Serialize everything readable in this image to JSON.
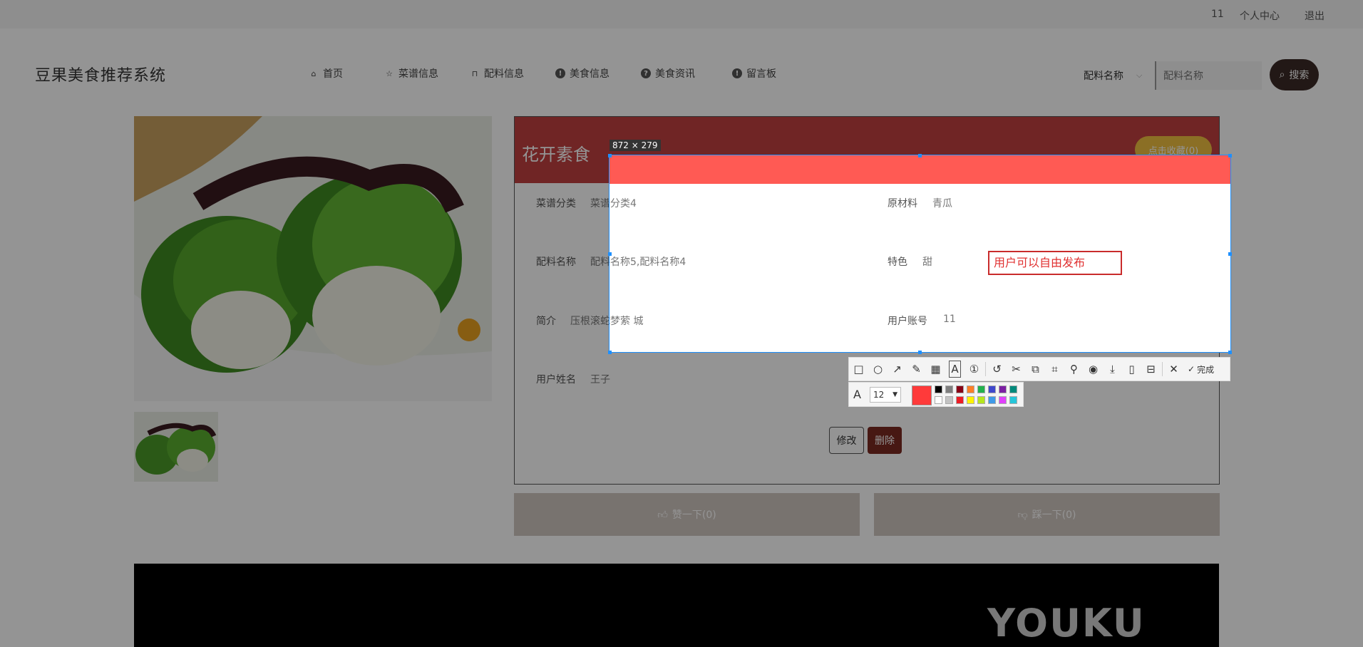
{
  "topbar": {
    "user_id": "11",
    "profile_link": "个人中心",
    "logout_link": "退出"
  },
  "site": {
    "title": "豆果美食推荐系统"
  },
  "nav": {
    "items": [
      {
        "label": "首页",
        "icon": "home-icon"
      },
      {
        "label": "菜谱信息",
        "icon": "star-icon"
      },
      {
        "label": "配料信息",
        "icon": "bag-icon"
      },
      {
        "label": "美食信息",
        "icon": "info-icon"
      },
      {
        "label": "美食资讯",
        "icon": "help-icon"
      },
      {
        "label": "留言板",
        "icon": "info-icon"
      }
    ]
  },
  "search": {
    "select_value": "配料名称",
    "placeholder": "配料名称",
    "button_label": "搜索"
  },
  "dish": {
    "title": "花开素食",
    "favorite_label": "点击收藏(0)",
    "fields": {
      "category_label": "菜谱分类",
      "category_value": "菜谱分类4",
      "material_label": "原材料",
      "material_value": "青瓜",
      "ingredient_label": "配料名称",
      "ingredient_value": "配料名称5,配料名称4",
      "feature_label": "特色",
      "feature_value": "甜",
      "intro_label": "简介",
      "intro_value": "压根滚蛇梦萦 城",
      "account_label": "用户账号",
      "account_value": "11",
      "username_label": "用户姓名",
      "username_value": "王子"
    },
    "edit_label": "修改",
    "delete_label": "删除",
    "like_label": "赞一下(0)",
    "dislike_label": "踩一下(0)"
  },
  "video": {
    "watermark": "YOUKU"
  },
  "screenshot_tool": {
    "size_label": "872 × 279",
    "annotation_text": "用户可以自由发布",
    "done_label": "完成",
    "font_size": "12",
    "current_color": "#ff3a3a",
    "tools": [
      "rect-icon",
      "ellipse-icon",
      "arrow-icon",
      "pen-icon",
      "mosaic-icon",
      "text-icon",
      "number-icon",
      "undo-icon",
      "scissors-icon",
      "copy-icon",
      "scan-icon",
      "pin-icon",
      "record-icon",
      "download-icon",
      "phone-icon",
      "bookmark-icon",
      "close-icon"
    ],
    "palette_top": [
      "#000000",
      "#7f7f7f",
      "#880015",
      "#ff7f27",
      "#22b14c",
      "#3f48cc",
      "#7b1fa2",
      "#00897b"
    ],
    "palette_bottom": [
      "#ffffff",
      "#c3c3c3",
      "#ed1c24",
      "#fff200",
      "#b5e61d",
      "#3f9ae8",
      "#e040fb",
      "#26c6da"
    ]
  }
}
